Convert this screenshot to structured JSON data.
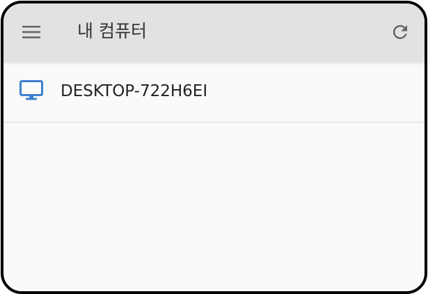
{
  "header": {
    "title": "내 컴퓨터",
    "menu_icon": "hamburger-menu-icon",
    "refresh_icon": "refresh-icon"
  },
  "computers": [
    {
      "name": "DESKTOP-722H6EI",
      "icon": "desktop-computer-icon"
    }
  ],
  "colors": {
    "appbar": "#e2e2e2",
    "background": "#fafafa",
    "icon_gray": "#666666",
    "computer_icon_blue": "#3f7fce",
    "frame_border": "#000000"
  }
}
